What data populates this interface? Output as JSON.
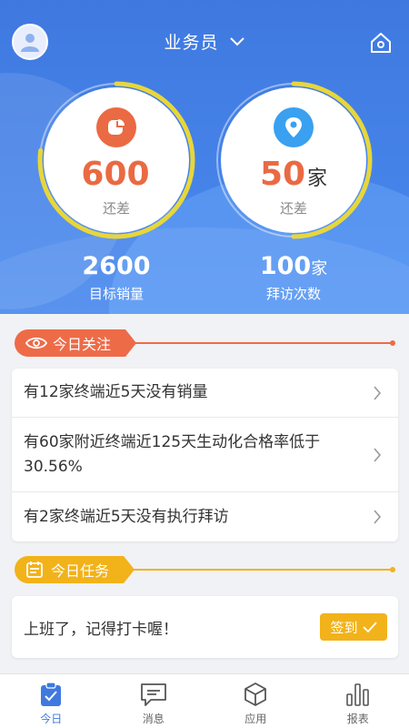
{
  "header": {
    "role": "业务员",
    "gauges": [
      {
        "value": "600",
        "unit": "",
        "sub": "还差",
        "progress": 0.77,
        "icon": "pie-chart-icon",
        "color": "#ea6a43"
      },
      {
        "value": "50",
        "unit": "家",
        "sub": "还差",
        "progress": 0.5,
        "icon": "location-pin-icon",
        "color": "#3aa0f0"
      }
    ],
    "targets": [
      {
        "num": "2600",
        "unit": "",
        "label": "目标销量"
      },
      {
        "num": "100",
        "unit": "家",
        "label": "拜访次数"
      }
    ]
  },
  "focus": {
    "title": "今日关注",
    "color": "#ee6b48",
    "items": [
      "有12家终端近5天没有销量",
      "有60家附近终端近125天生动化合格率低于30.56%",
      "有2家终端近5天没有执行拜访"
    ]
  },
  "tasks": {
    "title": "今日任务",
    "color": "#f2b21a",
    "text": "上班了，记得打卡喔！",
    "button": "签到"
  },
  "tabs": [
    {
      "label": "今日",
      "icon": "clipboard-check-icon",
      "active": true
    },
    {
      "label": "消息",
      "icon": "message-icon",
      "active": false
    },
    {
      "label": "应用",
      "icon": "cube-icon",
      "active": false
    },
    {
      "label": "报表",
      "icon": "bar-chart-icon",
      "active": false
    }
  ],
  "colors": {
    "primary": "#3f79e0",
    "accent_orange": "#ee6b48",
    "accent_yellow": "#f2b21a",
    "ring_yellow": "#e8d63a"
  }
}
